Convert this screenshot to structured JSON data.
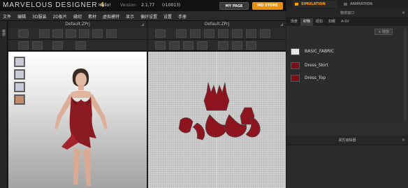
{
  "app": {
    "brand_name": "MARVELOUS DESIGNER",
    "brand_version": "4",
    "greeting": "Hello!",
    "version_label": "Version:",
    "version_number": "2.1.77",
    "build": "(r10013)",
    "my_page": "MY PAGE",
    "md_store": "MD STORE",
    "accent_color": "#ffa100"
  },
  "mode_tabs": [
    "SIMULATION",
    "ANIMATION"
  ],
  "menu": [
    "文件",
    "编辑",
    "3D服装",
    "2D板片",
    "缝纫",
    "素材",
    "虚拟模特",
    "显示",
    "偏好设置",
    "设置",
    "手册"
  ],
  "left_strip_label": "模特",
  "viewports": {
    "v3d_title": "Default.ZPrj",
    "v2d_title": "Default.ZPrj"
  },
  "avatar_icons": [
    "avatar-body-icon",
    "avatar-shaded-icon",
    "avatar-texture-icon",
    "avatar-skin-icon"
  ],
  "right_panel": {
    "title": "物体窗口",
    "tabs": [
      "场景",
      "织物",
      "纽扣",
      "扣眼",
      "A-SV"
    ],
    "add_button": "+ 增加",
    "fabrics": [
      {
        "name": "BASIC_FABRIC",
        "color": "#e8e8e8"
      },
      {
        "name": "Dress_Skirt",
        "color": "#7a1018"
      },
      {
        "name": "Dress_Top",
        "color": "#7a1018"
      }
    ],
    "property_title": "属性编辑器"
  }
}
